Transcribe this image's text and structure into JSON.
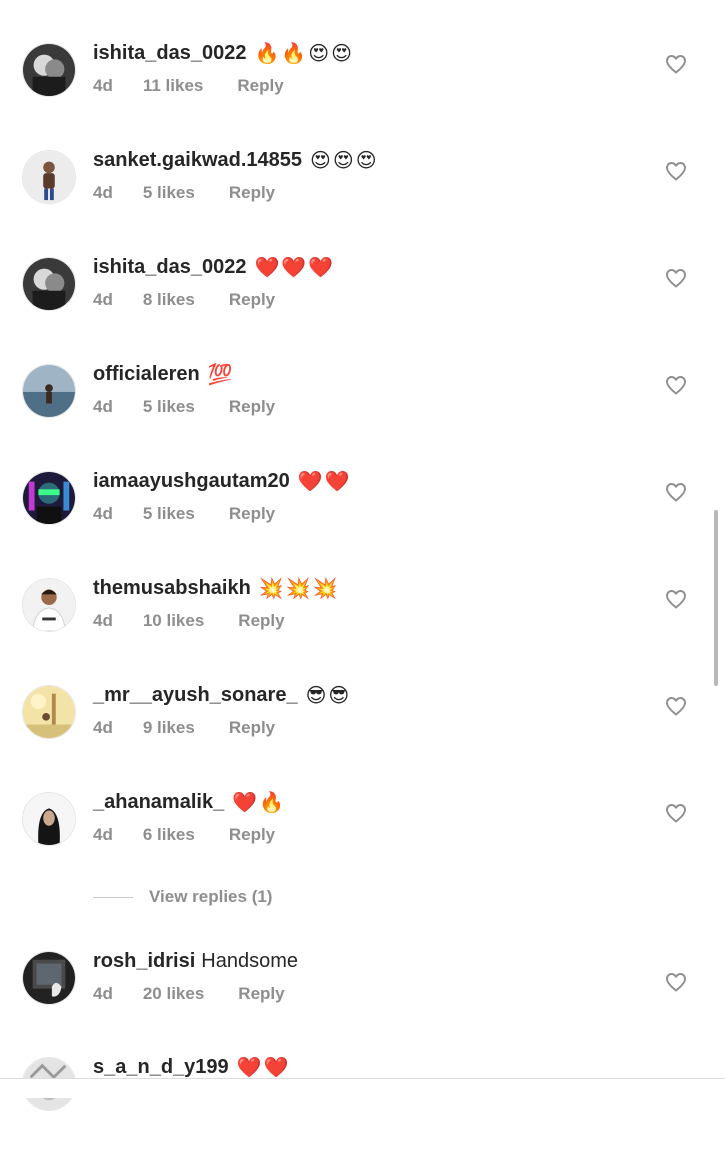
{
  "comments": [
    {
      "username": "ishita_das_0022",
      "text": "🔥🔥😍😍",
      "time": "4d",
      "likes": "11 likes",
      "reply": "Reply",
      "avatar": "dark-couple-photo"
    },
    {
      "username": "sanket.gaikwad.14855",
      "text": "😍😍😍",
      "time": "4d",
      "likes": "5 likes",
      "reply": "Reply",
      "avatar": "man-standing-light-background"
    },
    {
      "username": "ishita_das_0022",
      "text": "❤️❤️❤️",
      "time": "4d",
      "likes": "8 likes",
      "reply": "Reply",
      "avatar": "dark-couple-photo"
    },
    {
      "username": "officialeren",
      "text": "💯",
      "time": "4d",
      "likes": "5 likes",
      "reply": "Reply",
      "avatar": "person-in-sea"
    },
    {
      "username": "iamaayushgautam20",
      "text": "❤️❤️",
      "time": "4d",
      "likes": "5 likes",
      "reply": "Reply",
      "avatar": "neon-face-art"
    },
    {
      "username": "themusabshaikh",
      "text": "💥💥💥",
      "time": "4d",
      "likes": "10 likes",
      "reply": "Reply",
      "avatar": "man-white-tshirt"
    },
    {
      "username": "_mr__ayush_sonare_",
      "text": "😎😎",
      "time": "4d",
      "likes": "9 likes",
      "reply": "Reply",
      "avatar": "sunny-outdoor-photo"
    },
    {
      "username": "_ahanamalik_",
      "text": "❤️🔥",
      "time": "4d",
      "likes": "6 likes",
      "reply": "Reply",
      "avatar": "woman-dark-hair"
    },
    {
      "username": "rosh_idrisi",
      "text": "Handsome",
      "time": "4d",
      "likes": "20 likes",
      "reply": "Reply",
      "avatar": "dark-framed-photo"
    },
    {
      "username": "s_a_n_d_y199",
      "text": "❤️❤️",
      "time": "",
      "likes": "",
      "reply": "",
      "avatar": "grey-sketch"
    }
  ],
  "view_replies": "View replies (1)",
  "colors": {
    "username": "#262626",
    "meta": "#8e8e8e",
    "heart_outline": "#8e8e8e",
    "background": "#ffffff"
  }
}
